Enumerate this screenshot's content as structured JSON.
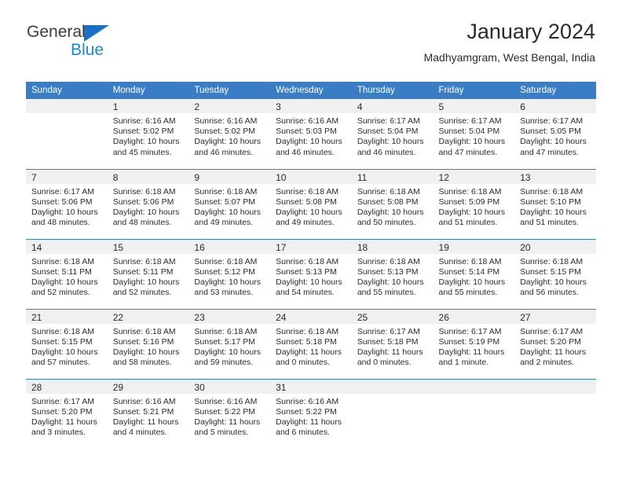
{
  "brand": {
    "name_part1": "General",
    "name_part2": "Blue",
    "accent_color": "#1a71c4",
    "logo_icon": "triangle-icon"
  },
  "header": {
    "title": "January 2024",
    "subtitle": "Madhyamgram, West Bengal, India"
  },
  "calendar": {
    "header_bg": "#3b7dc4",
    "daynum_bg": "#f0f0f0",
    "weekdays": [
      "Sunday",
      "Monday",
      "Tuesday",
      "Wednesday",
      "Thursday",
      "Friday",
      "Saturday"
    ],
    "weeks": [
      [
        {
          "day": "",
          "blank": true,
          "sunrise": "",
          "sunset": "",
          "daylight1": "",
          "daylight2": ""
        },
        {
          "day": "1",
          "blank": false,
          "sunrise": "Sunrise: 6:16 AM",
          "sunset": "Sunset: 5:02 PM",
          "daylight1": "Daylight: 10 hours",
          "daylight2": "and 45 minutes."
        },
        {
          "day": "2",
          "blank": false,
          "sunrise": "Sunrise: 6:16 AM",
          "sunset": "Sunset: 5:02 PM",
          "daylight1": "Daylight: 10 hours",
          "daylight2": "and 46 minutes."
        },
        {
          "day": "3",
          "blank": false,
          "sunrise": "Sunrise: 6:16 AM",
          "sunset": "Sunset: 5:03 PM",
          "daylight1": "Daylight: 10 hours",
          "daylight2": "and 46 minutes."
        },
        {
          "day": "4",
          "blank": false,
          "sunrise": "Sunrise: 6:17 AM",
          "sunset": "Sunset: 5:04 PM",
          "daylight1": "Daylight: 10 hours",
          "daylight2": "and 46 minutes."
        },
        {
          "day": "5",
          "blank": false,
          "sunrise": "Sunrise: 6:17 AM",
          "sunset": "Sunset: 5:04 PM",
          "daylight1": "Daylight: 10 hours",
          "daylight2": "and 47 minutes."
        },
        {
          "day": "6",
          "blank": false,
          "sunrise": "Sunrise: 6:17 AM",
          "sunset": "Sunset: 5:05 PM",
          "daylight1": "Daylight: 10 hours",
          "daylight2": "and 47 minutes."
        }
      ],
      [
        {
          "day": "7",
          "blank": false,
          "sunrise": "Sunrise: 6:17 AM",
          "sunset": "Sunset: 5:06 PM",
          "daylight1": "Daylight: 10 hours",
          "daylight2": "and 48 minutes."
        },
        {
          "day": "8",
          "blank": false,
          "sunrise": "Sunrise: 6:18 AM",
          "sunset": "Sunset: 5:06 PM",
          "daylight1": "Daylight: 10 hours",
          "daylight2": "and 48 minutes."
        },
        {
          "day": "9",
          "blank": false,
          "sunrise": "Sunrise: 6:18 AM",
          "sunset": "Sunset: 5:07 PM",
          "daylight1": "Daylight: 10 hours",
          "daylight2": "and 49 minutes."
        },
        {
          "day": "10",
          "blank": false,
          "sunrise": "Sunrise: 6:18 AM",
          "sunset": "Sunset: 5:08 PM",
          "daylight1": "Daylight: 10 hours",
          "daylight2": "and 49 minutes."
        },
        {
          "day": "11",
          "blank": false,
          "sunrise": "Sunrise: 6:18 AM",
          "sunset": "Sunset: 5:08 PM",
          "daylight1": "Daylight: 10 hours",
          "daylight2": "and 50 minutes."
        },
        {
          "day": "12",
          "blank": false,
          "sunrise": "Sunrise: 6:18 AM",
          "sunset": "Sunset: 5:09 PM",
          "daylight1": "Daylight: 10 hours",
          "daylight2": "and 51 minutes."
        },
        {
          "day": "13",
          "blank": false,
          "sunrise": "Sunrise: 6:18 AM",
          "sunset": "Sunset: 5:10 PM",
          "daylight1": "Daylight: 10 hours",
          "daylight2": "and 51 minutes."
        }
      ],
      [
        {
          "day": "14",
          "blank": false,
          "sunrise": "Sunrise: 6:18 AM",
          "sunset": "Sunset: 5:11 PM",
          "daylight1": "Daylight: 10 hours",
          "daylight2": "and 52 minutes."
        },
        {
          "day": "15",
          "blank": false,
          "sunrise": "Sunrise: 6:18 AM",
          "sunset": "Sunset: 5:11 PM",
          "daylight1": "Daylight: 10 hours",
          "daylight2": "and 52 minutes."
        },
        {
          "day": "16",
          "blank": false,
          "sunrise": "Sunrise: 6:18 AM",
          "sunset": "Sunset: 5:12 PM",
          "daylight1": "Daylight: 10 hours",
          "daylight2": "and 53 minutes."
        },
        {
          "day": "17",
          "blank": false,
          "sunrise": "Sunrise: 6:18 AM",
          "sunset": "Sunset: 5:13 PM",
          "daylight1": "Daylight: 10 hours",
          "daylight2": "and 54 minutes."
        },
        {
          "day": "18",
          "blank": false,
          "sunrise": "Sunrise: 6:18 AM",
          "sunset": "Sunset: 5:13 PM",
          "daylight1": "Daylight: 10 hours",
          "daylight2": "and 55 minutes."
        },
        {
          "day": "19",
          "blank": false,
          "sunrise": "Sunrise: 6:18 AM",
          "sunset": "Sunset: 5:14 PM",
          "daylight1": "Daylight: 10 hours",
          "daylight2": "and 55 minutes."
        },
        {
          "day": "20",
          "blank": false,
          "sunrise": "Sunrise: 6:18 AM",
          "sunset": "Sunset: 5:15 PM",
          "daylight1": "Daylight: 10 hours",
          "daylight2": "and 56 minutes."
        }
      ],
      [
        {
          "day": "21",
          "blank": false,
          "sunrise": "Sunrise: 6:18 AM",
          "sunset": "Sunset: 5:15 PM",
          "daylight1": "Daylight: 10 hours",
          "daylight2": "and 57 minutes."
        },
        {
          "day": "22",
          "blank": false,
          "sunrise": "Sunrise: 6:18 AM",
          "sunset": "Sunset: 5:16 PM",
          "daylight1": "Daylight: 10 hours",
          "daylight2": "and 58 minutes."
        },
        {
          "day": "23",
          "blank": false,
          "sunrise": "Sunrise: 6:18 AM",
          "sunset": "Sunset: 5:17 PM",
          "daylight1": "Daylight: 10 hours",
          "daylight2": "and 59 minutes."
        },
        {
          "day": "24",
          "blank": false,
          "sunrise": "Sunrise: 6:18 AM",
          "sunset": "Sunset: 5:18 PM",
          "daylight1": "Daylight: 11 hours",
          "daylight2": "and 0 minutes."
        },
        {
          "day": "25",
          "blank": false,
          "sunrise": "Sunrise: 6:17 AM",
          "sunset": "Sunset: 5:18 PM",
          "daylight1": "Daylight: 11 hours",
          "daylight2": "and 0 minutes."
        },
        {
          "day": "26",
          "blank": false,
          "sunrise": "Sunrise: 6:17 AM",
          "sunset": "Sunset: 5:19 PM",
          "daylight1": "Daylight: 11 hours",
          "daylight2": "and 1 minute."
        },
        {
          "day": "27",
          "blank": false,
          "sunrise": "Sunrise: 6:17 AM",
          "sunset": "Sunset: 5:20 PM",
          "daylight1": "Daylight: 11 hours",
          "daylight2": "and 2 minutes."
        }
      ],
      [
        {
          "day": "28",
          "blank": false,
          "sunrise": "Sunrise: 6:17 AM",
          "sunset": "Sunset: 5:20 PM",
          "daylight1": "Daylight: 11 hours",
          "daylight2": "and 3 minutes."
        },
        {
          "day": "29",
          "blank": false,
          "sunrise": "Sunrise: 6:16 AM",
          "sunset": "Sunset: 5:21 PM",
          "daylight1": "Daylight: 11 hours",
          "daylight2": "and 4 minutes."
        },
        {
          "day": "30",
          "blank": false,
          "sunrise": "Sunrise: 6:16 AM",
          "sunset": "Sunset: 5:22 PM",
          "daylight1": "Daylight: 11 hours",
          "daylight2": "and 5 minutes."
        },
        {
          "day": "31",
          "blank": false,
          "sunrise": "Sunrise: 6:16 AM",
          "sunset": "Sunset: 5:22 PM",
          "daylight1": "Daylight: 11 hours",
          "daylight2": "and 6 minutes."
        },
        {
          "day": "",
          "blank": true,
          "sunrise": "",
          "sunset": "",
          "daylight1": "",
          "daylight2": ""
        },
        {
          "day": "",
          "blank": true,
          "sunrise": "",
          "sunset": "",
          "daylight1": "",
          "daylight2": ""
        },
        {
          "day": "",
          "blank": true,
          "sunrise": "",
          "sunset": "",
          "daylight1": "",
          "daylight2": ""
        }
      ]
    ]
  }
}
